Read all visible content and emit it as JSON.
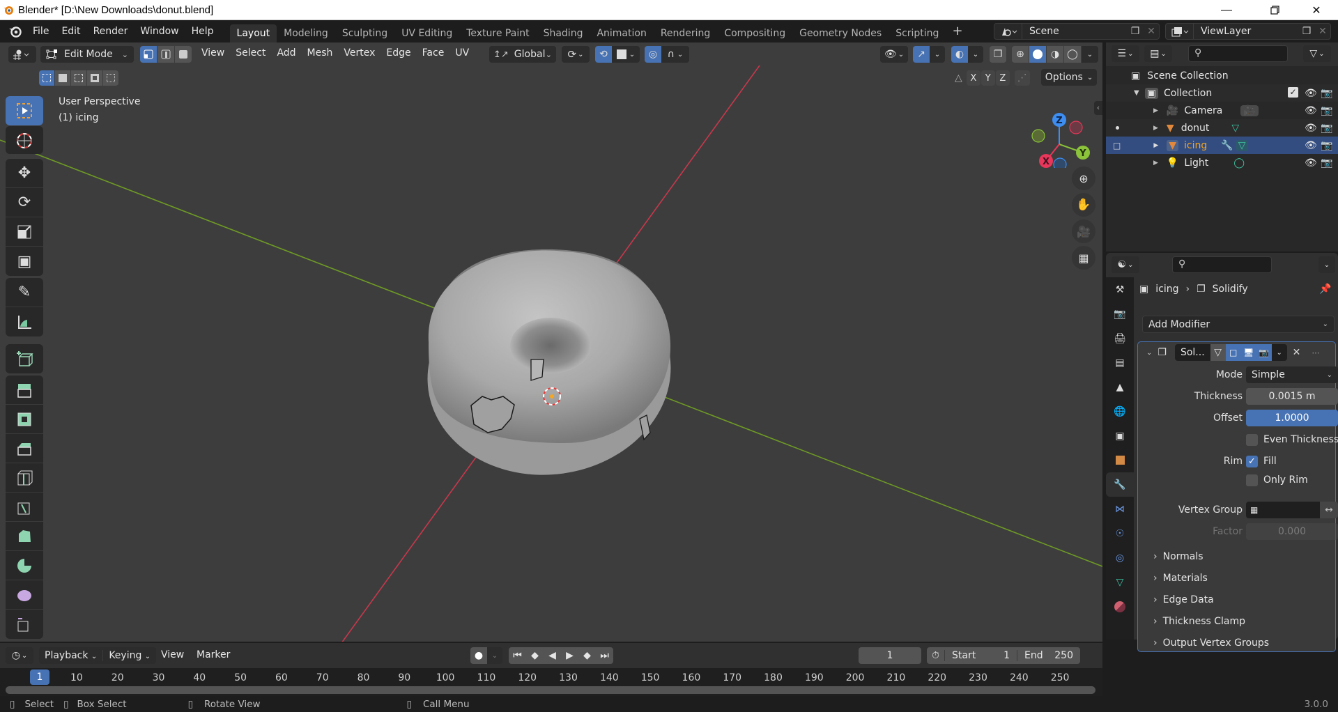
{
  "window": {
    "title": "Blender* [D:\\New Downloads\\donut.blend]",
    "controls": [
      "minimize",
      "maximize",
      "close"
    ]
  },
  "topbar": {
    "menus": [
      "File",
      "Edit",
      "Render",
      "Window",
      "Help"
    ],
    "workspaces": [
      {
        "label": "Layout",
        "active": true
      },
      {
        "label": "Modeling"
      },
      {
        "label": "Sculpting"
      },
      {
        "label": "UV Editing"
      },
      {
        "label": "Texture Paint"
      },
      {
        "label": "Shading"
      },
      {
        "label": "Animation"
      },
      {
        "label": "Rendering"
      },
      {
        "label": "Compositing"
      },
      {
        "label": "Geometry Nodes"
      },
      {
        "label": "Scripting"
      }
    ],
    "add_workspace": "+",
    "scene": "Scene",
    "view_layer": "ViewLayer"
  },
  "viewport": {
    "mode": "Edit Mode",
    "menus": [
      "View",
      "Select",
      "Add",
      "Mesh",
      "Vertex",
      "Edge",
      "Face",
      "UV"
    ],
    "transform_orientation": "Global",
    "overlay_label_1": "User Perspective",
    "overlay_label_2": "(1) icing",
    "mirror_axes": [
      "X",
      "Y",
      "Z"
    ],
    "options_label": "Options",
    "gizmo": {
      "x": "X",
      "y": "Y",
      "z": "Z"
    },
    "shading_active": "solid",
    "colors": {
      "x_axis": "#e8375a",
      "y_axis": "#8bc33a",
      "z_axis": "#3d8ef0",
      "select": "#4772b3"
    }
  },
  "outliner": {
    "root": "Scene Collection",
    "collection": "Collection",
    "items": [
      {
        "name": "Camera",
        "type": "camera",
        "selected": false
      },
      {
        "name": "donut",
        "type": "mesh",
        "selected": false
      },
      {
        "name": "icing",
        "type": "mesh",
        "selected": true,
        "has_modifier": true
      },
      {
        "name": "Light",
        "type": "light",
        "selected": false
      }
    ]
  },
  "properties": {
    "breadcrumb_object": "icing",
    "breadcrumb_modifier": "Solidify",
    "add_modifier": "Add Modifier",
    "modifier_name": "Sol...",
    "fields": {
      "mode_label": "Mode",
      "mode_value": "Simple",
      "thickness_label": "Thickness",
      "thickness_value": "0.0015 m",
      "offset_label": "Offset",
      "offset_value": "1.0000",
      "even_thickness_label": "Even Thickness",
      "even_thickness": false,
      "rim_label": "Rim",
      "fill_label": "Fill",
      "fill": true,
      "only_rim_label": "Only Rim",
      "only_rim": false,
      "vertex_group_label": "Vertex Group",
      "vertex_group_value": "",
      "factor_label": "Factor",
      "factor_value": "0.000"
    },
    "subpanels": [
      "Normals",
      "Materials",
      "Edge Data",
      "Thickness Clamp",
      "Output Vertex Groups"
    ]
  },
  "timeline": {
    "menus": [
      "Playback",
      "Keying",
      "View",
      "Marker"
    ],
    "current_frame": "1",
    "start_label": "Start",
    "start": "1",
    "end_label": "End",
    "end": "250",
    "ruler_current": "1",
    "ruler_ticks": [
      "10",
      "20",
      "30",
      "40",
      "50",
      "60",
      "70",
      "80",
      "90",
      "100",
      "110",
      "120",
      "130",
      "140",
      "150",
      "160",
      "170",
      "180",
      "190",
      "200",
      "210",
      "220",
      "230",
      "240",
      "250"
    ]
  },
  "statusbar": {
    "hints": [
      "Select",
      "Box Select",
      "Rotate View",
      "Call Menu"
    ],
    "version": "3.0.0"
  }
}
